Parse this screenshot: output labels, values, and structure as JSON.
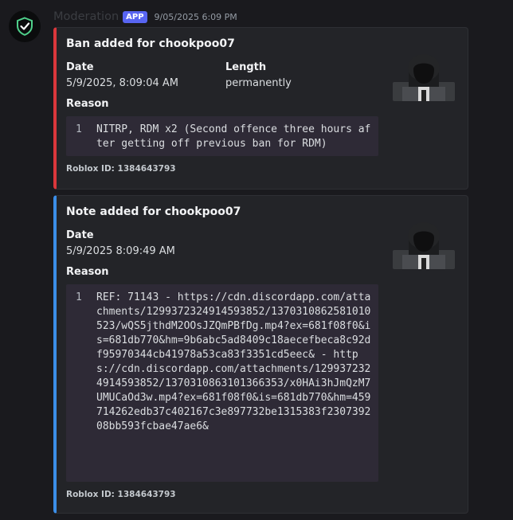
{
  "message": {
    "username": "Moderation",
    "app_badge": "APP",
    "timestamp": "9/05/2025 6:09 PM",
    "avatar_icon": "shield-check-icon"
  },
  "embeds": [
    {
      "kind": "ban",
      "accent_color": "#da373c",
      "title": "Ban added for chookpoo07",
      "date_label": "Date",
      "date_value": "5/9/2025, 8:09:04 AM",
      "length_label": "Length",
      "length_value": "permanently",
      "reason_label": "Reason",
      "reason_line_number": "1",
      "reason_text": "NITRP, RDM x2 (Second offence three hours after getting off previous ban for RDM)",
      "footer": "Roblox ID: 1384643793",
      "thumbnail_icon": "roblox-avatar-thumbnail"
    },
    {
      "kind": "note",
      "accent_color": "#3b8ee8",
      "title": "Note added for chookpoo07",
      "date_label": "Date",
      "date_value": "5/9/2025 8:09:49 AM",
      "reason_label": "Reason",
      "reason_line_number": "1",
      "reason_text": "REF: 71143 - https://cdn.discordapp.com/attachments/1299372324914593852/1370310862581010523/wQS5jthdM2OOsJZQmPBfDg.mp4?ex=681f08f0&is=681db770&hm=9b6abc5ad8409c18aecefbeca8c92df95970344cb41978a53ca83f3351cd5eec& - https://cdn.discordapp.com/attachments/1299372324914593852/1370310863101366353/x0HAi3hJmQzM7UMUCaOd3w.mp4?ex=681f08f0&is=681db770&hm=459714262edb37c402167c3e897732be1315383f230739208bb593fcbae47ae6&",
      "footer": "Roblox ID: 1384643793",
      "thumbnail_icon": "roblox-avatar-thumbnail"
    }
  ]
}
